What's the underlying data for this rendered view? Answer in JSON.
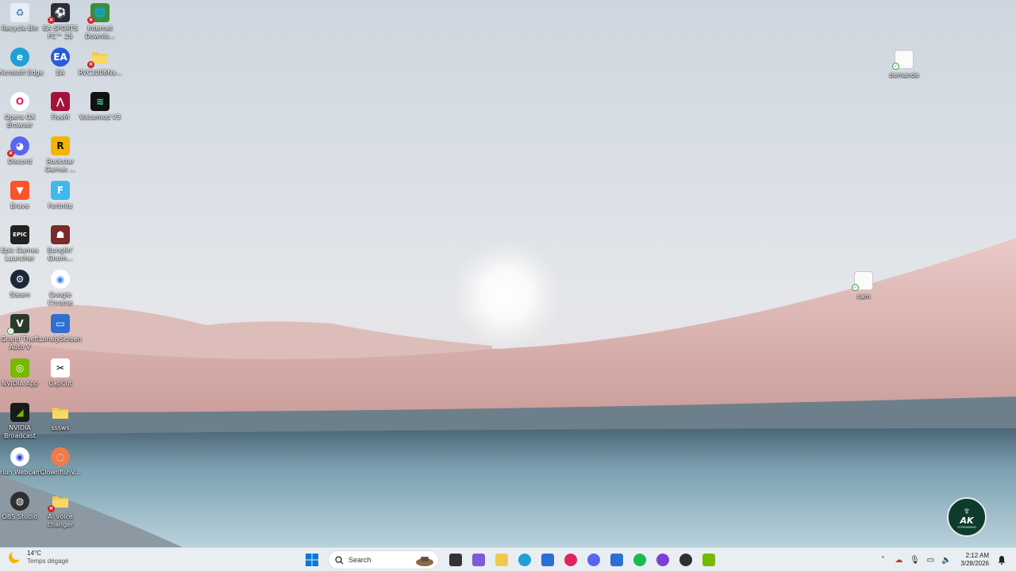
{
  "desktop": {
    "icons": [
      {
        "label": "Recycle Bin",
        "icon": "recycle-bin-icon",
        "color": "#e8eef5",
        "glyph": "♻",
        "fg": "#4a7fb5",
        "badge": ""
      },
      {
        "label": "EA SPORTS FC™ 25",
        "icon": "ea-fc-icon",
        "color": "#2b2b3a",
        "glyph": "⚽",
        "fg": "#fff",
        "badge": "err"
      },
      {
        "label": "Internet Downlo...",
        "icon": "internet-download-manager-icon",
        "color": "#3c8c3c",
        "glyph": "🌐",
        "fg": "#fff",
        "badge": "err"
      },
      {
        "label": "Microsoft Edge",
        "icon": "edge-icon",
        "color": "#1fa0d6",
        "glyph": "e",
        "fg": "#fff",
        "badge": ""
      },
      {
        "label": "EA",
        "icon": "ea-icon",
        "color": "#2a5bd7",
        "glyph": "EA",
        "fg": "#fff",
        "badge": ""
      },
      {
        "label": "RVC1006Nv...",
        "icon": "folder-icon",
        "color": "#f2c94c",
        "glyph": "",
        "fg": "#fff",
        "badge": "err"
      },
      {
        "label": "Opera GX Browser",
        "icon": "opera-gx-icon",
        "color": "#ffffff",
        "glyph": "O",
        "fg": "#e0245e",
        "badge": ""
      },
      {
        "label": "FiveM",
        "icon": "fivem-icon",
        "color": "#a3123a",
        "glyph": "⋀",
        "fg": "#fff",
        "badge": ""
      },
      {
        "label": "Voicemod V3",
        "icon": "voicemod-icon",
        "color": "#111",
        "glyph": "≋",
        "fg": "#2ee6a6",
        "badge": ""
      },
      {
        "label": "Discord",
        "icon": "discord-icon",
        "color": "#5865f2",
        "glyph": "◕",
        "fg": "#fff",
        "badge": "err"
      },
      {
        "label": "Rockstar Games ...",
        "icon": "rockstar-icon",
        "color": "#f4b400",
        "glyph": "R",
        "fg": "#111",
        "badge": ""
      },
      {
        "label": "Brave",
        "icon": "brave-icon",
        "color": "#fb542b",
        "glyph": "▼",
        "fg": "#fff",
        "badge": ""
      },
      {
        "label": "Fortnite",
        "icon": "fortnite-icon",
        "color": "#3fb8f0",
        "glyph": "F",
        "fg": "#fff",
        "badge": ""
      },
      {
        "label": "Epic Games Launcher",
        "icon": "epic-games-icon",
        "color": "#222",
        "glyph": "EPIC",
        "fg": "#fff",
        "badge": ""
      },
      {
        "label": "Bunglin' Gnom...",
        "icon": "game-icon",
        "color": "#7a2a2a",
        "glyph": "☗",
        "fg": "#fff",
        "badge": ""
      },
      {
        "label": "Steam",
        "icon": "steam-icon",
        "color": "#1b2838",
        "glyph": "⚙",
        "fg": "#fff",
        "badge": ""
      },
      {
        "label": "Google Chrome",
        "icon": "chrome-icon",
        "color": "#ffffff",
        "glyph": "◉",
        "fg": "#4285f4",
        "badge": ""
      },
      {
        "label": "Grand Theft Auto V",
        "icon": "gta-v-icon",
        "color": "#2a3a2a",
        "glyph": "V",
        "fg": "#fff",
        "badge": "ok"
      },
      {
        "label": "LonelyScreen",
        "icon": "lonelyscreen-icon",
        "color": "#2f6fd0",
        "glyph": "▭",
        "fg": "#fff",
        "badge": ""
      },
      {
        "label": "NVIDIA App",
        "icon": "nvidia-icon",
        "color": "#76b900",
        "glyph": "◎",
        "fg": "#fff",
        "badge": ""
      },
      {
        "label": "CapCut",
        "icon": "capcut-icon",
        "color": "#ffffff",
        "glyph": "✂",
        "fg": "#000",
        "badge": ""
      },
      {
        "label": "NVIDIA Broadcast",
        "icon": "nvidia-broadcast-icon",
        "color": "#1a1a1a",
        "glyph": "◢",
        "fg": "#76b900",
        "badge": ""
      },
      {
        "label": "sssws",
        "icon": "folder-icon",
        "color": "#f2c94c",
        "glyph": "",
        "fg": "#fff",
        "badge": ""
      },
      {
        "label": "Iriun Webcam",
        "icon": "iriun-webcam-icon",
        "color": "#ffffff",
        "glyph": "◉",
        "fg": "#2a4bd0",
        "badge": ""
      },
      {
        "label": "ClownfishV...",
        "icon": "clownfish-icon",
        "color": "#f07a4a",
        "glyph": "◌",
        "fg": "#fff",
        "badge": ""
      },
      {
        "label": "OBS Studio",
        "icon": "obs-studio-icon",
        "color": "#302e31",
        "glyph": "◍",
        "fg": "#fff",
        "badge": ""
      },
      {
        "label": "Ai voice changer",
        "icon": "folder-icon",
        "color": "#f2c94c",
        "glyph": "",
        "fg": "#fff",
        "badge": "err"
      }
    ],
    "files": [
      {
        "label": "demande",
        "icon": "text-document-icon"
      },
      {
        "label": "cam",
        "icon": "document-icon"
      }
    ],
    "watermark": {
      "title": "AK",
      "subtitle": "STREAMING"
    }
  },
  "taskbar": {
    "weather": {
      "temp": "14°C",
      "condition": "Temps dégagé"
    },
    "search_placeholder": "Search",
    "pinned": [
      {
        "name": "task-view-icon",
        "color": "#333"
      },
      {
        "name": "copilot-icon",
        "color": "#7b5cd6"
      },
      {
        "name": "file-explorer-icon",
        "color": "#f2c94c"
      },
      {
        "name": "edge-icon",
        "color": "#1fa0d6"
      },
      {
        "name": "microsoft-store-icon",
        "color": "#2a6fd6"
      },
      {
        "name": "opera-gx-icon",
        "color": "#e0245e"
      },
      {
        "name": "discord-icon",
        "color": "#5865f2"
      },
      {
        "name": "remote-desktop-icon",
        "color": "#2f6fd0"
      },
      {
        "name": "spotify-icon",
        "color": "#1db954"
      },
      {
        "name": "opera-icon",
        "color": "#7b3fd6"
      },
      {
        "name": "obs-studio-icon",
        "color": "#302e31"
      },
      {
        "name": "nvidia-broadcast-icon",
        "color": "#76b900"
      }
    ],
    "tray": {
      "time": "2:12 AM",
      "date": "3/28/2026",
      "icons": [
        "chevron-up-icon",
        "onedrive-icon",
        "microphone-icon",
        "network-icon",
        "volume-icon",
        "notification-icon"
      ]
    }
  }
}
